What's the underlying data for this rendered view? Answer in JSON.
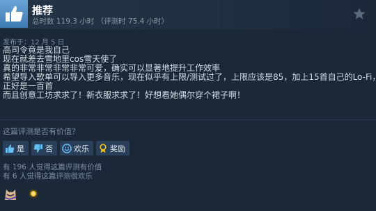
{
  "review": {
    "verdict": "推荐",
    "playtime": "总时数 119.3 小时 （评测时 75.4 小时）",
    "posted": "发布于：12 月 5 日",
    "lines": [
      "高司令竟是我自己",
      "现在就差去雪地里cos雪天使了",
      "真的非常非常非常非常可爱，确实可以显著地提升工作效率",
      "希望导入歌单可以导入更多音乐，现在似乎有上限/测试过了，上限应该是85，加上15首自己的Lo-Fi，",
      "正好是一百首",
      "而且创意工坊求求了！新衣服求求了！好想看她偶尔穿个裙子啊！"
    ]
  },
  "feedback": {
    "question": "这篇评测是否有价值？",
    "yes": "是",
    "no": "否",
    "funny": "欢乐",
    "award": "奖励",
    "helpful_count": "有 196 人觉得这篇评测有价值",
    "funny_count": "有 6 人觉得这篇评测很欢乐"
  },
  "icons": {
    "verdict": "thumbs-up-icon",
    "star": "star-icon",
    "yes": "thumbs-up-icon",
    "no": "thumbs-down-icon",
    "funny": "smiley-icon",
    "award": "award-ribbon-icon"
  },
  "colors": {
    "background": "#1b2838",
    "accent": "#66c0f4",
    "award": "#f1c40f"
  }
}
